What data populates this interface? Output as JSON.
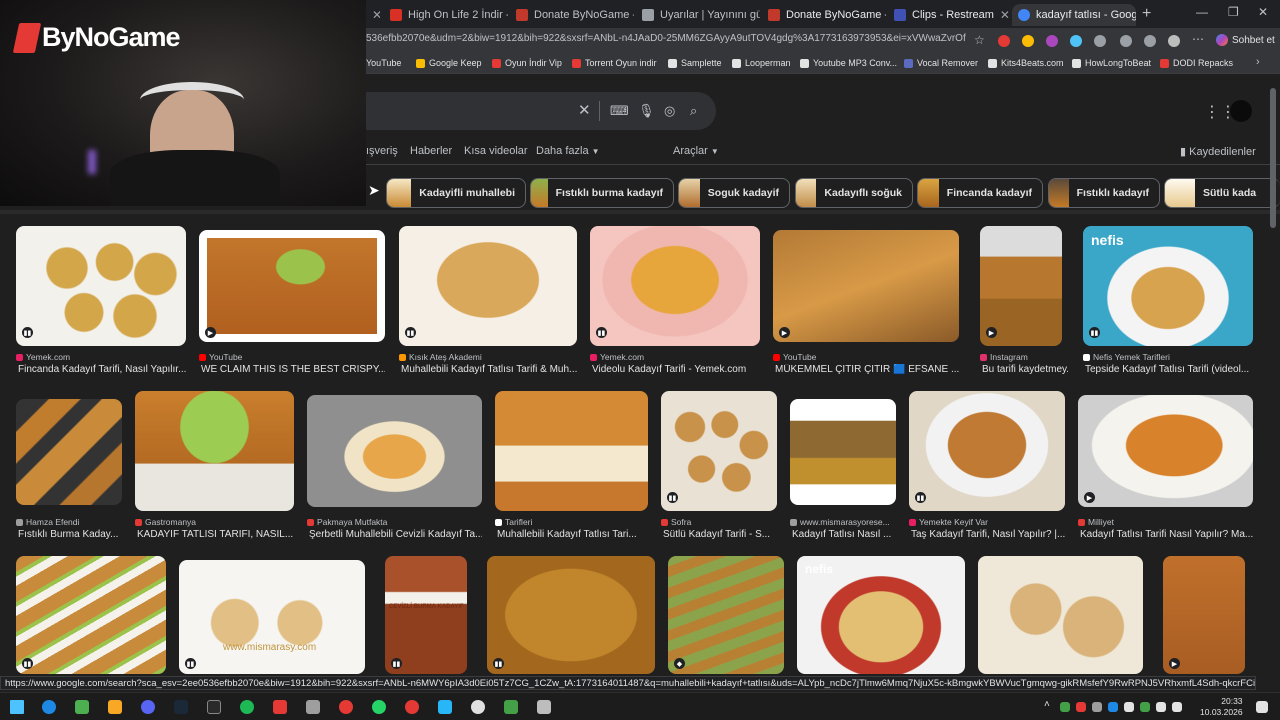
{
  "browser": {
    "tabs": [
      {
        "label": "High On Life 2 İndir - Fu",
        "color": "#d93025"
      },
      {
        "label": "Donate ByNoGame - Ult",
        "color": "#c0392b"
      },
      {
        "label": "Uyarılar | Yayınını güçlen",
        "color": "#9aa0a6"
      },
      {
        "label": "Donate ByNoGame - Stre",
        "color": "#c0392b"
      },
      {
        "label": "Clips - Restream",
        "color": "#3f51b5"
      },
      {
        "label": "kadayıf tatlısı - Google'd",
        "color": "#4285f4"
      }
    ],
    "url": "536efbb2070e&udm=2&biw=1912&bih=922&sxsrf=ANbL-n4JAaD0-25MM6ZGAyyA9utTOV4gdg%3A1773163973953&ei=xVWwaZvrOfrxc8P...",
    "sohbet_label": "Sohbet et",
    "bookmarks": [
      {
        "label": "YouTube",
        "color": "#ff0000"
      },
      {
        "label": "Google Keep",
        "color": "#fbbc04"
      },
      {
        "label": "Oyun İndir Vip",
        "color": "#e53935"
      },
      {
        "label": "Torrent Oyun indir",
        "color": "#e53935"
      },
      {
        "label": "Samplette",
        "color": "#e3e3e3"
      },
      {
        "label": "Looperman",
        "color": "#e3e3e3"
      },
      {
        "label": "Youtube MP3 Conv...",
        "color": "#e3e3e3"
      },
      {
        "label": "Vocal Remover",
        "color": "#5c6bc0"
      },
      {
        "label": "Kits4Beats.com",
        "color": "#e3e3e3"
      },
      {
        "label": "HowLongToBeat",
        "color": "#e3e3e3"
      },
      {
        "label": "DODI Repacks",
        "color": "#e53935"
      }
    ]
  },
  "google": {
    "nav_partial": "ışveriş",
    "nav": [
      "Haberler",
      "Kısa videolar",
      "Daha fazla"
    ],
    "tools": "Araçlar",
    "saved": "Kaydedilenler",
    "chips": [
      {
        "label": "Kadayifli muhallebi"
      },
      {
        "label": "Fıstıklı burma kadayıf"
      },
      {
        "label": "Soguk kadayif"
      },
      {
        "label": "Kadayıflı soğuk"
      },
      {
        "label": "Fincanda kadayıf"
      },
      {
        "label": "Fıstıklı kadayıf"
      },
      {
        "label": "Sütlü kada"
      }
    ]
  },
  "results": [
    {
      "source": "Yemek.com",
      "title": "Fincanda Kadayıf Tarifi, Nasıl Yapılır...",
      "srcColor": "#e91e63"
    },
    {
      "source": "YouTube",
      "title": "WE CLAIM THIS IS THE BEST CRISPY...",
      "srcColor": "#ff0000"
    },
    {
      "source": "Kısık Ateş Akademi",
      "title": "Muhallebili Kadayıf Tatlısı Tarifi & Muh...",
      "srcColor": "#ff9800"
    },
    {
      "source": "Yemek.com",
      "title": "Videolu Kadayıf Tarifi - Yemek.com",
      "srcColor": "#e91e63"
    },
    {
      "source": "YouTube",
      "title": "MÜKEMMEL ÇITIR ÇITIR 🟦 EFSANE ...",
      "srcColor": "#ff0000"
    },
    {
      "source": "Instagram",
      "title": "Bu tarifi kaydetmey...",
      "srcColor": "#e1306c"
    },
    {
      "source": "Nefis Yemek Tarifleri",
      "title": "Tepside Kadayıf Tatlısı Tarifi (videol...",
      "srcColor": "#ffffff"
    },
    {
      "source": "Hamza Efendi",
      "title": "Fıstıklı Burma Kaday...",
      "srcColor": "#9e9e9e"
    },
    {
      "source": "Gastromanya",
      "title": "KADAYIF TATLISI TARİFİ, NASIL...",
      "srcColor": "#e53935"
    },
    {
      "source": "Pakmaya Mutfakta",
      "title": "Şerbetli Muhallebili Cevizli Kadayıf Ta...",
      "srcColor": "#e53935"
    },
    {
      "source": "Tarifleri",
      "title": "Muhallebili Kadayıf Tatlısı Tari...",
      "srcColor": "#ffffff"
    },
    {
      "source": "Sofra",
      "title": "Sütlü Kadayıf Tarifi - S...",
      "srcColor": "#e53935"
    },
    {
      "source": "www.mismarasyorese...",
      "title": "Kadayıf Tatlısı Nasıl ...",
      "srcColor": "#9e9e9e"
    },
    {
      "source": "Yemekte Keyif Var",
      "title": "Taş Kadayıf Tarifi, Nasıl Yapılır? |...",
      "srcColor": "#e91e63"
    },
    {
      "source": "Milliyet",
      "title": "Kadayıf Tatlısı Tarifi Nasıl Yapılır? Ma...",
      "srcColor": "#e53935"
    }
  ],
  "row3_labels": {
    "img2_watermark": "www.mismarasy.com",
    "img3_caption": "CEVİZLİ BURMA KADAYIF",
    "img6_brand": "nefis"
  },
  "status_url": "https://www.google.com/search?sca_esv=2ee0536efbb2070e&biw=1912&bih=922&sxsrf=ANbL-n6MWY6pIA3d0Ei05Tz7CG_1CZw_tA:1773164011487&q=muhallebili+kadayıf+tatlısı&uds=ALYpb_ncDc7jTlmw6Mmq7NjuX5c-kBmgwkYBWVucTgmqwg-gikRMsfefY9RwRPNJ5VRhxmfL4Sdh-qkcrFCiE-Vrna...",
  "overlay": {
    "logo": "ByNoGame"
  },
  "clock": {
    "time": "20:33",
    "date": "10.03.2026"
  }
}
